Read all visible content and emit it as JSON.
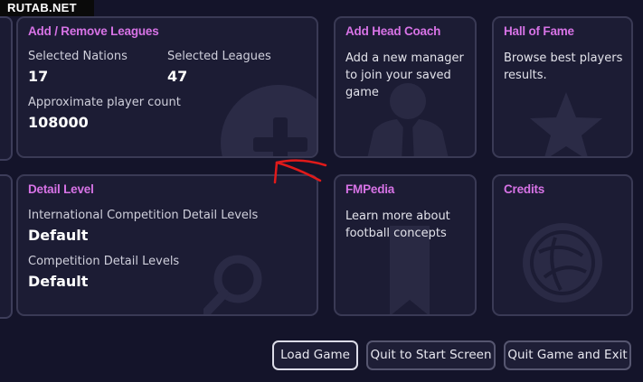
{
  "watermark": "RUTAB.NET",
  "leagues_card": {
    "title": "Add / Remove Leagues",
    "nations_label": "Selected Nations",
    "nations_value": "17",
    "leagues_label": "Selected Leagues",
    "leagues_value": "47",
    "players_label": "Approximate player count",
    "players_value": "108000",
    "bg_icon": "plus-icon"
  },
  "coach_card": {
    "title": "Add Head Coach",
    "text": "Add a new manager to join your saved game",
    "bg_icon": "manager-icon"
  },
  "fame_card": {
    "title": "Hall of Fame",
    "text": "Browse best players results.",
    "bg_icon": "star-icon"
  },
  "detail_card": {
    "title": "Detail Level",
    "intl_label": "International Competition Detail Levels",
    "intl_value": "Default",
    "comp_label": "Competition Detail Levels",
    "comp_value": "Default",
    "bg_icon": "magnifier-icon"
  },
  "fmpedia_card": {
    "title": "FMPedia",
    "text": "Learn more about football concepts",
    "bg_icon": "bookmark-icon"
  },
  "credits_card": {
    "title": "Credits",
    "bg_icon": "football-icon"
  },
  "buttons": {
    "load": "Load Game",
    "quit_start": "Quit to Start Screen",
    "quit_exit": "Quit Game and Exit"
  },
  "colors": {
    "background": "#14142a",
    "card": "#1c1c34",
    "card_border": "#3a3a55",
    "title_accent": "#d773e6",
    "annotation": "#e01a1a"
  }
}
